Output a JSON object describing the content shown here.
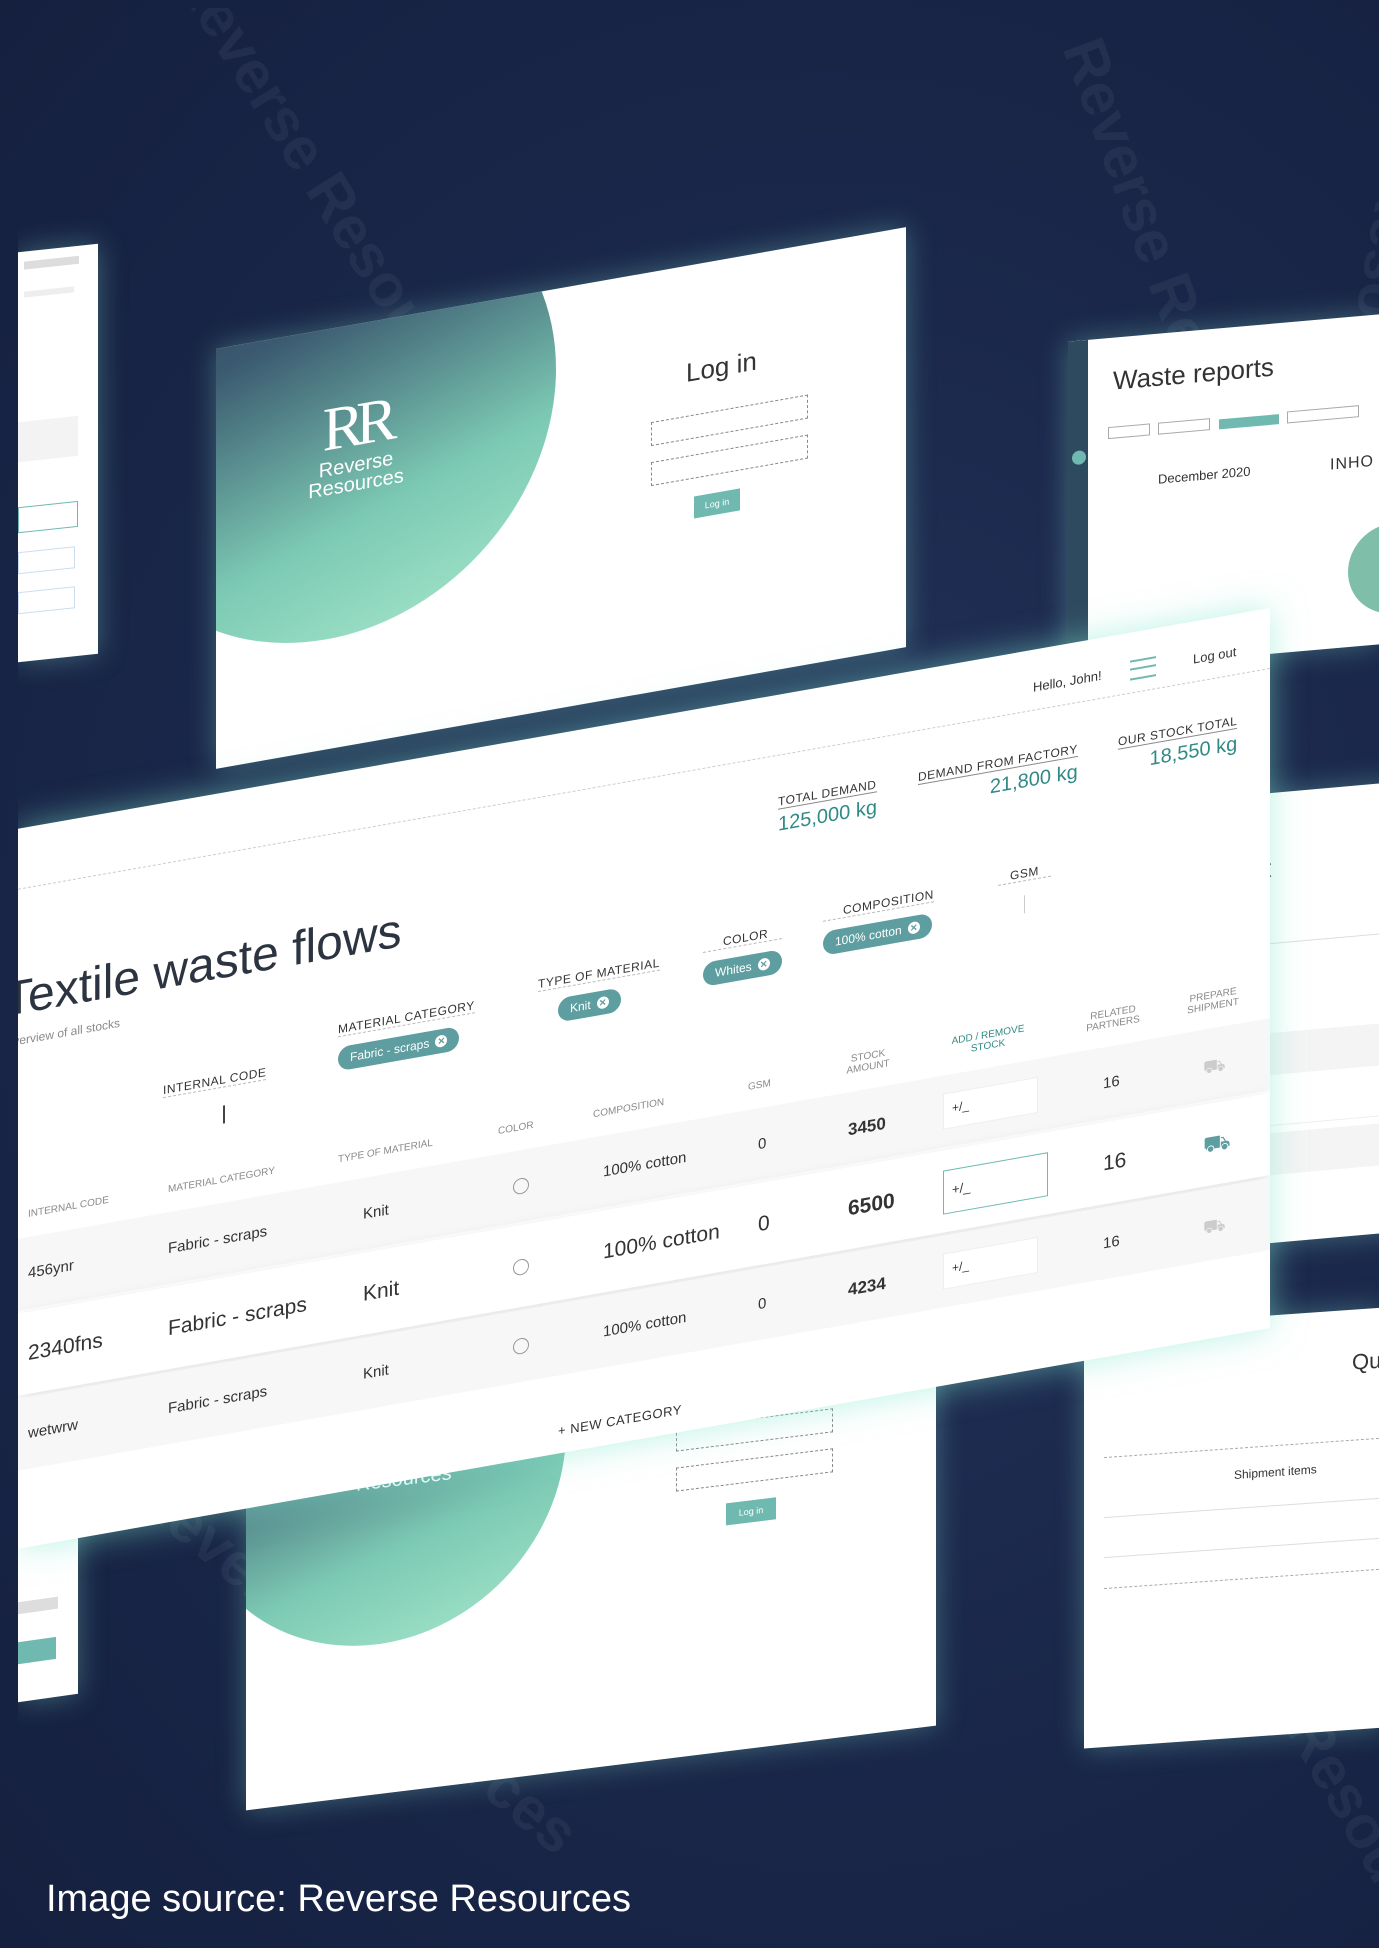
{
  "caption": "Image source: Reverse Resources",
  "watermark": "Reverse Resources",
  "login": {
    "logo_text": "Reverse\nResources",
    "logo_mark": "RR",
    "title": "Log in",
    "button": "Log in"
  },
  "waste_reports": {
    "title": "Waste reports",
    "month": "December 2020",
    "tab_partial": "INHO"
  },
  "main": {
    "greeting": "Hello, John!",
    "logout": "Log out",
    "title": "Textile waste flows",
    "subtitle": "Overview of all stocks",
    "stats": [
      {
        "label": "TOTAL DEMAND",
        "value": "125,000 kg"
      },
      {
        "label": "DEMAND FROM FACTORY",
        "value": "21,800 kg"
      },
      {
        "label": "OUR STOCK TOTAL",
        "value": "18,550 kg"
      }
    ],
    "filters": {
      "internal_code": "INTERNAL CODE",
      "material_category": "MATERIAL CATEGORY",
      "type_of_material": "TYPE OF MATERIAL",
      "color": "COLOR",
      "composition": "COMPOSITION",
      "gsm": "GSM",
      "chips": {
        "material_category": "Fabric - scraps",
        "type_of_material": "Knit",
        "color": "Whites",
        "composition": "100% cotton"
      }
    },
    "columns": [
      "INTERNAL CODE",
      "MATERIAL CATEGORY",
      "TYPE OF MATERIAL",
      "COLOR",
      "COMPOSITION",
      "GSM",
      "STOCK AMOUNT",
      "ADD / REMOVE STOCK",
      "RELATED PARTNERS",
      "PREPARE SHIPMENT"
    ],
    "rows": [
      {
        "code": "456ynr",
        "category": "Fabric - scraps",
        "type": "Knit",
        "composition": "100% cotton",
        "gsm": "0",
        "stock": "3450",
        "adjust": "+/_",
        "partners": "16"
      },
      {
        "code": "2340fns",
        "category": "Fabric - scraps",
        "type": "Knit",
        "composition": "100% cotton",
        "gsm": "0",
        "stock": "6500",
        "adjust": "+/_",
        "partners": "16"
      },
      {
        "code": "wetwrw",
        "category": "Fabric - scraps",
        "type": "Knit",
        "composition": "100% cotton",
        "gsm": "0",
        "stock": "4234",
        "adjust": "+/_",
        "partners": "16"
      }
    ],
    "new_category": "+ NEW CATEGORY"
  },
  "lower_right": {
    "title_partial": "Qua",
    "shipment_items": "Shipment items"
  }
}
